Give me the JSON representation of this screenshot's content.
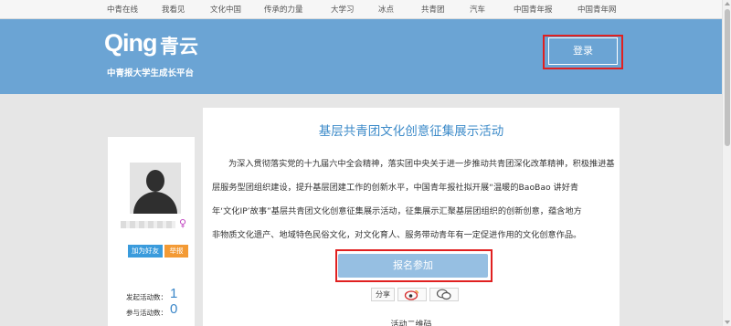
{
  "topnav": {
    "items": [
      "中青在线",
      "我看见",
      "文化中国",
      "传承的力量",
      "大学习",
      "冰点",
      "共青团",
      "汽车",
      "中国青年报",
      "中国青年网"
    ]
  },
  "header": {
    "logo_latin": "Qing",
    "logo_cn": "青云",
    "subtitle": "中青报大学生成长平台",
    "login_label": "登录"
  },
  "profile": {
    "gender_icon": "♀",
    "add_friend_label": "加为好友",
    "report_label": "举报",
    "stats": [
      {
        "label": "发起活动数：",
        "value": "1"
      },
      {
        "label": "参与活动数：",
        "value": "0"
      }
    ]
  },
  "activity": {
    "title": "基层共青团文化创意征集展示活动",
    "description_lines": [
      "为深入贯彻落实党的十九届六中全会精神，落实团中央关于进一步推动共青团深化改革精神，积极推进基",
      "层服务型团组织建设，提升基层团建工作的创新水平，中国青年报社拟开展“温暖的BaoBao 讲好青",
      "年‘文化IP’故事”基层共青团文化创意征集展示活动，征集展示汇聚基层团组织的创新创意，蕴含地方",
      "非物质文化遗产、地域特色民俗文化，对文化育人、服务带动青年有一定促进作用的文化创意作品。"
    ],
    "signup_label": "报名参加",
    "share_label": "分享",
    "qr_caption": "活动二维码"
  },
  "colors": {
    "banner": "#6ba4d4",
    "title": "#3d8bc9",
    "signup_button": "#96bfe2",
    "add_friend": "#3a9bdc",
    "report": "#f39a35",
    "highlight": "#e02020"
  }
}
